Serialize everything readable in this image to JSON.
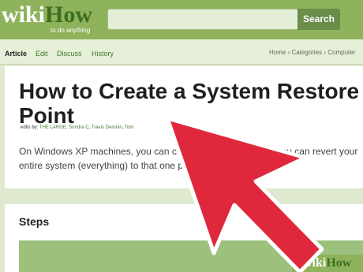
{
  "header": {
    "logo": {
      "wiki": "wiki",
      "how": "How",
      "tagline": "to do anything"
    },
    "search": {
      "placeholder": "",
      "button_label": "Search"
    }
  },
  "tabs": [
    {
      "label": "Article",
      "active": true
    },
    {
      "label": "Edit",
      "active": false
    },
    {
      "label": "Discuss",
      "active": false
    },
    {
      "label": "History",
      "active": false
    }
  ],
  "breadcrumb": "Home › Categories › Computer",
  "article": {
    "title": "How to Create a System Restore Point",
    "edits_prefix": "edits by:",
    "editors": [
      "THE LARGE",
      "Sondra C",
      "Travis Derouin",
      "Tom"
    ],
    "intro": "On Windows XP machines, you can create a restore point so you can revert your entire system (everything) to that one point."
  },
  "steps": {
    "heading": "Steps"
  },
  "watermark": {
    "wiki": "wiki",
    "how": "How"
  },
  "overlay": {
    "shape": "arrow-cursor",
    "color": "#e0283c",
    "outline": "#ffffff"
  },
  "colors": {
    "brand": "#8fb35c",
    "brand_dark": "#3e6e21",
    "link": "#3d7a2b"
  }
}
